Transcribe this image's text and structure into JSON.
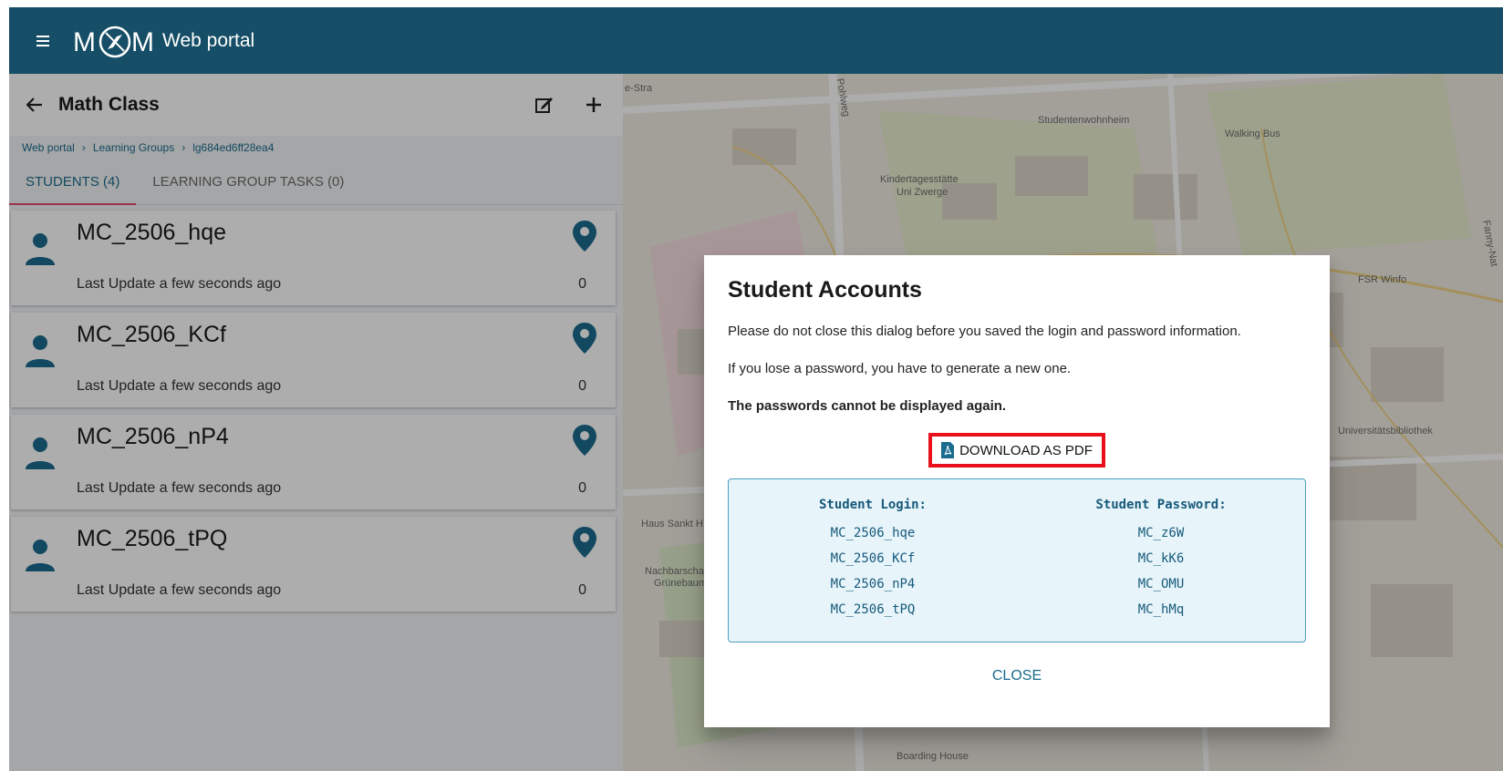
{
  "appbar": {
    "logo_text_left": "M",
    "logo_text_right": "M",
    "title": "Web portal"
  },
  "panel": {
    "title": "Math Class",
    "breadcrumb": [
      "Web portal",
      "Learning Groups",
      "lg684ed6ff28ea4"
    ],
    "tabs": [
      {
        "label": "STUDENTS (4)",
        "active": true
      },
      {
        "label": "LEARNING GROUP TASKS (0)",
        "active": false
      }
    ],
    "students": [
      {
        "name": "MC_2506_hqe",
        "update": "Last Update a few seconds ago",
        "count": "0"
      },
      {
        "name": "MC_2506_KCf",
        "update": "Last Update a few seconds ago",
        "count": "0"
      },
      {
        "name": "MC_2506_nP4",
        "update": "Last Update a few seconds ago",
        "count": "0"
      },
      {
        "name": "MC_2506_tPQ",
        "update": "Last Update a few seconds ago",
        "count": "0"
      }
    ]
  },
  "map": {
    "labels": [
      "e-Stra",
      "Pohlweg",
      "Studentenwohnheim",
      "Walking Bus",
      "Kindertagesstätte",
      "Uni Zwerge",
      "FSR Winfo",
      "Fanny-Nat",
      "Universitätsbibliothek",
      "Haus Sankt H",
      "Nachbarscha",
      "Grünebaum",
      "Boarding House"
    ]
  },
  "dialog": {
    "title": "Student Accounts",
    "line1": "Please do not close this dialog before you saved the login and password information.",
    "line2": "If you lose a password, you have to generate a new one.",
    "line3": "The passwords cannot be displayed again.",
    "download_label": "DOWNLOAD AS PDF",
    "login_header": "Student Login:",
    "password_header": "Student Password:",
    "credentials": [
      {
        "login": "MC_2506_hqe",
        "password": "MC_z6W"
      },
      {
        "login": "MC_2506_KCf",
        "password": "MC_kK6"
      },
      {
        "login": "MC_2506_nP4",
        "password": "MC_OMU"
      },
      {
        "login": "MC_2506_tPQ",
        "password": "MC_hMq"
      }
    ],
    "close_label": "CLOSE"
  },
  "colors": {
    "appbar": "#154e66",
    "accent": "#1b6c8e",
    "tab_indicator": "#e54d6f",
    "highlight": "#e8101b"
  }
}
